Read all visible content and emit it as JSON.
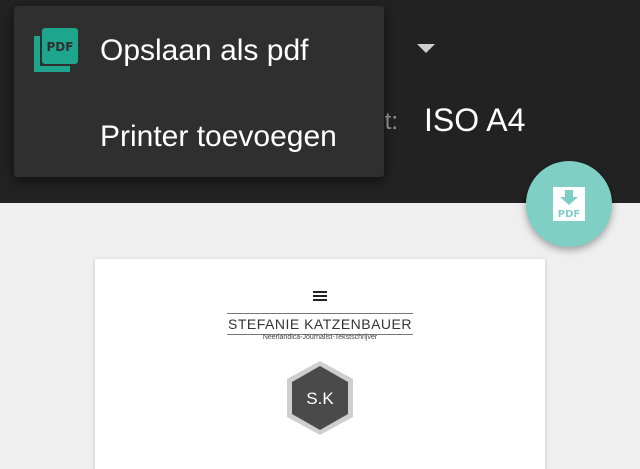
{
  "menu": {
    "items": [
      {
        "label": "Opslaan als pdf",
        "icon": "pdf-icon"
      },
      {
        "label": "Printer toevoegen"
      }
    ]
  },
  "settings": {
    "paper_label_fragment": "t:",
    "paper_size": "ISO A4"
  },
  "fab": {
    "icon": "download-pdf-icon",
    "icon_text": "PDF"
  },
  "preview": {
    "site_name": "STEFANIE KATZENBAUER",
    "tagline": "Neerlandica-Journalist-Tekstschrijver",
    "logo_initials": "S.K"
  },
  "colors": {
    "accent": "#7fcfc4",
    "pdf_icon": "#1ea58e",
    "top_bar": "#222222",
    "menu_bg": "#2f2f2f"
  }
}
